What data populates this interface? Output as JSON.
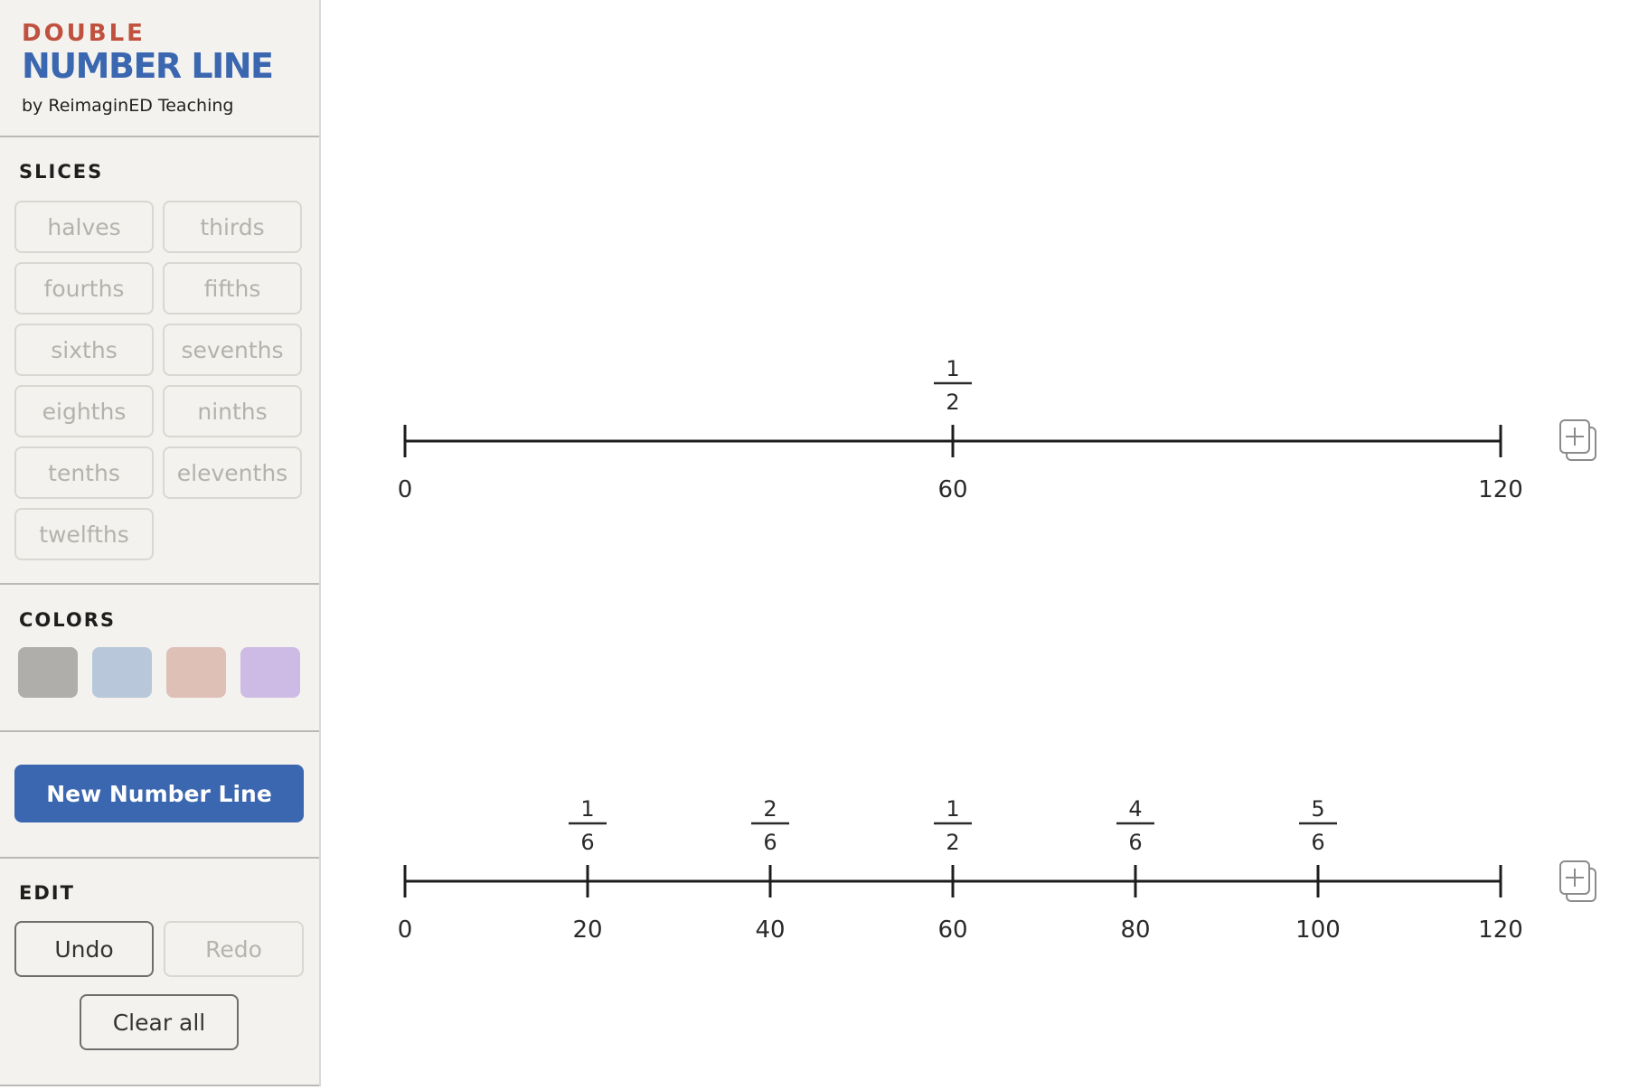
{
  "brand": {
    "line1": "DOUBLE",
    "line2": "NUMBER LINE",
    "line3": "by ReimaginED Teaching"
  },
  "slices": {
    "title": "SLICES",
    "items": [
      "halves",
      "thirds",
      "fourths",
      "fifths",
      "sixths",
      "sevenths",
      "eighths",
      "ninths",
      "tenths",
      "elevenths",
      "twelfths"
    ]
  },
  "colors": {
    "title": "COLORS",
    "swatches": [
      "#b3b2ae",
      "#bccbdd",
      "#e3c4bb",
      "#d2bfea"
    ]
  },
  "actions": {
    "new_line": "New Number Line"
  },
  "edit": {
    "title": "EDIT",
    "undo": "Undo",
    "redo": "Redo",
    "clear": "Clear all"
  },
  "number_lines": [
    {
      "ticks": [
        0,
        60,
        120
      ],
      "labels": [
        "0",
        "60",
        "120"
      ],
      "fractions": [
        {
          "at": 60,
          "num": "1",
          "den": "2"
        }
      ]
    },
    {
      "ticks": [
        0,
        20,
        40,
        60,
        80,
        100,
        120
      ],
      "labels": [
        "0",
        "20",
        "40",
        "60",
        "80",
        "100",
        "120"
      ],
      "fractions": [
        {
          "at": 20,
          "num": "1",
          "den": "6"
        },
        {
          "at": 40,
          "num": "2",
          "den": "6"
        },
        {
          "at": 60,
          "num": "1",
          "den": "2"
        },
        {
          "at": 80,
          "num": "4",
          "den": "6"
        },
        {
          "at": 100,
          "num": "5",
          "den": "6"
        }
      ]
    }
  ],
  "icons": {
    "duplicate": "duplicate-plus-icon"
  }
}
